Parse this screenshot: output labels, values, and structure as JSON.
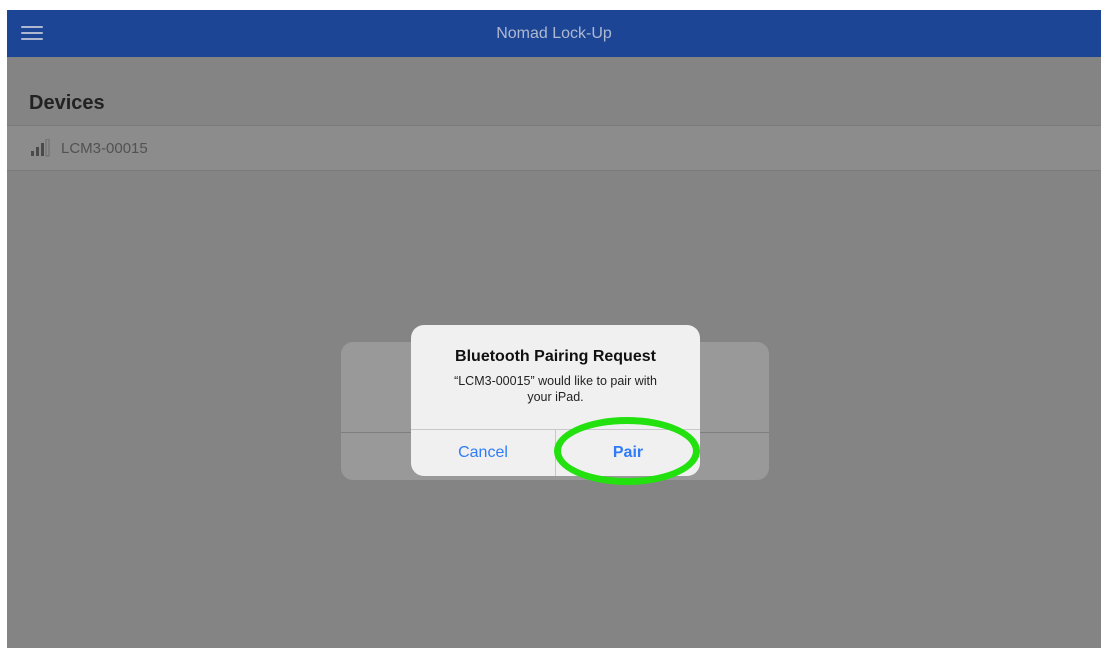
{
  "app": {
    "title": "Nomad Lock-Up",
    "menu_icon": "hamburger-menu-icon"
  },
  "devices": {
    "title": "Devices",
    "items": [
      {
        "name": "LCM3-00015",
        "icon": "signal-strength-icon"
      }
    ]
  },
  "alert": {
    "title": "Bluetooth Pairing Request",
    "message": "“LCM3-00015” would like to pair with your iPad.",
    "cancel_label": "Cancel",
    "pair_label": "Pair"
  },
  "colors": {
    "navbar": "#1d4595",
    "overlay": "#848484",
    "button_text": "#2f7cf6",
    "highlight_ring": "#22e10f"
  }
}
